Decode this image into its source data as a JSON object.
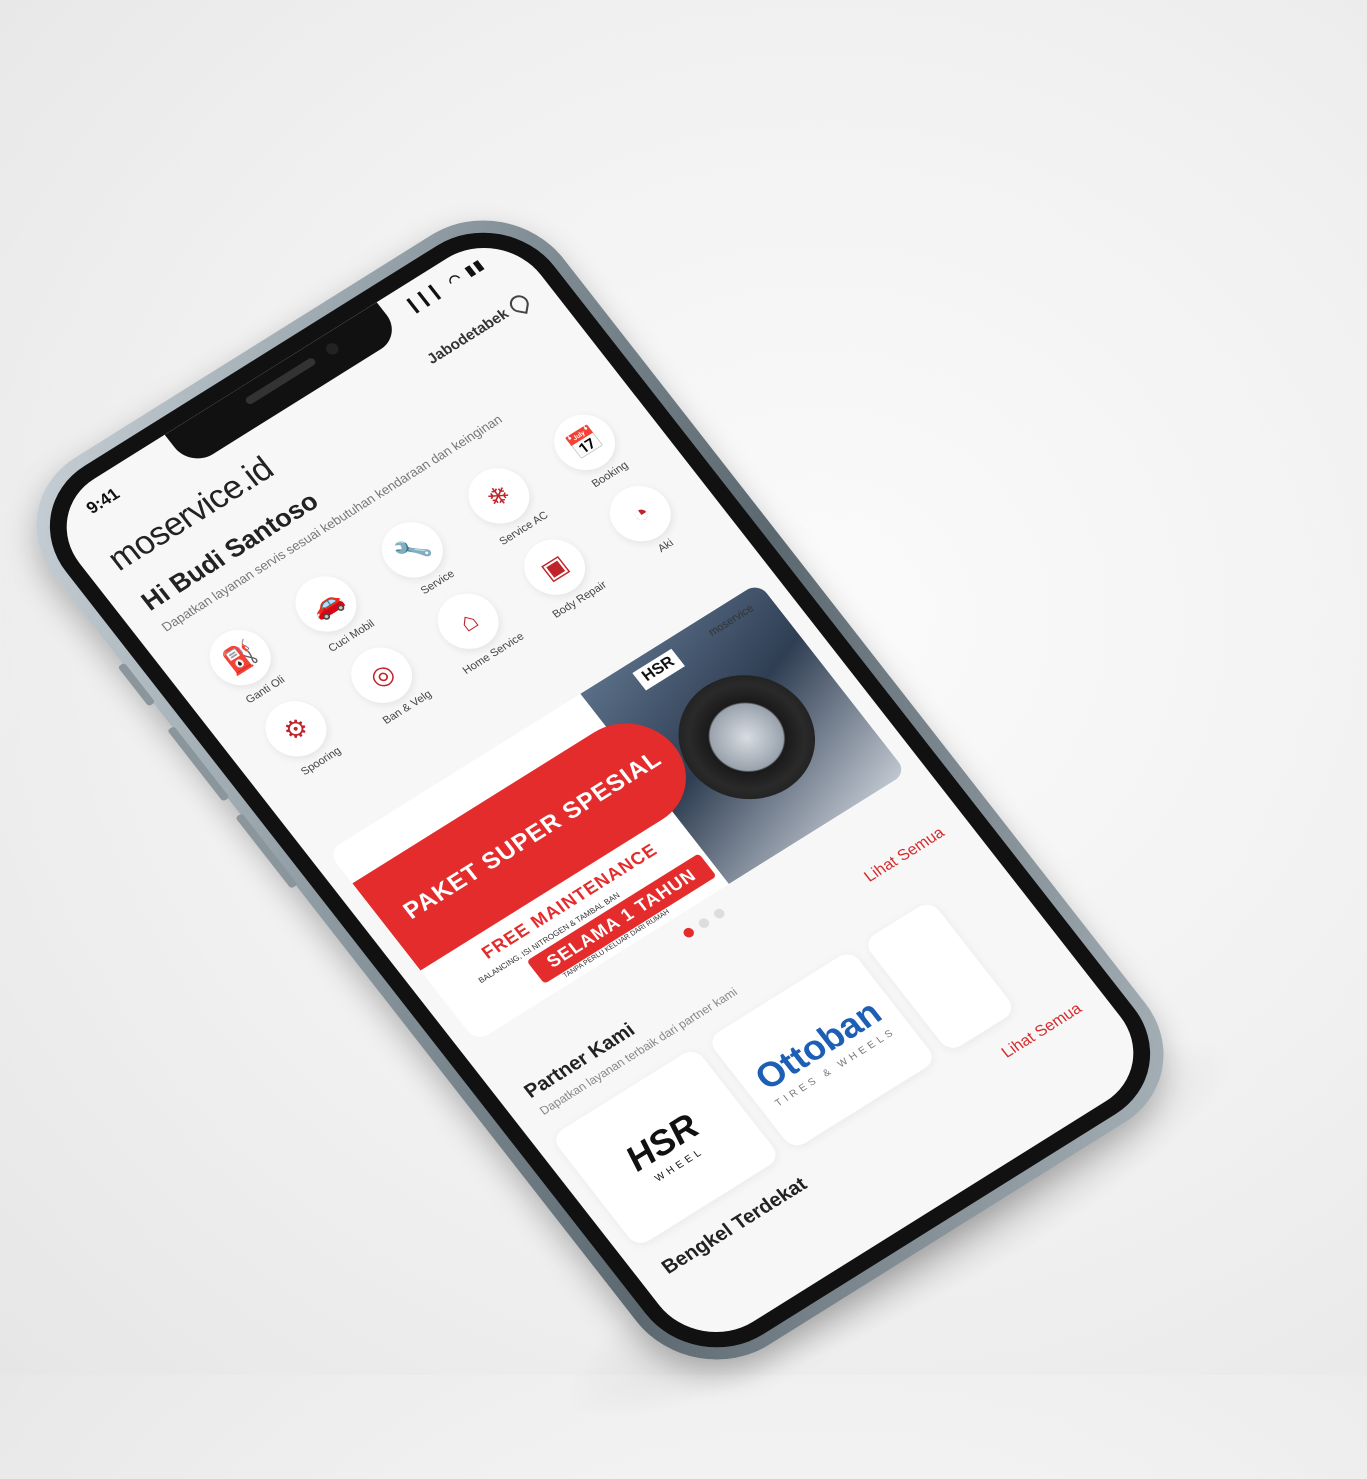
{
  "status_bar": {
    "time": "9:41",
    "icons": "▎▎▎ ◠ ▮▮"
  },
  "header": {
    "logo": "moservice.id",
    "location": "Jabodetabek"
  },
  "greeting": {
    "title": "Hi Budi Santoso",
    "subtitle": "Dapatkan layanan servis sesuai kebutuhan kendaraan dan keinginan"
  },
  "services": [
    {
      "label": "Ganti Oli",
      "icon": "oil-icon",
      "glyph": "⛽"
    },
    {
      "label": "Cuci Mobil",
      "icon": "car-wash-icon",
      "glyph": "🚗"
    },
    {
      "label": "Service",
      "icon": "wrench-icon",
      "glyph": "🔧"
    },
    {
      "label": "Service AC",
      "icon": "car-ac-icon",
      "glyph": "❄"
    },
    {
      "label": "Booking",
      "icon": "calendar-icon",
      "glyph": "📅"
    },
    {
      "label": "Spooring",
      "icon": "spooring-icon",
      "glyph": "⚙"
    },
    {
      "label": "Ban & Velg",
      "icon": "tire-icon",
      "glyph": "◎"
    },
    {
      "label": "Home Service",
      "icon": "home-icon",
      "glyph": "⌂"
    },
    {
      "label": "Body Repair",
      "icon": "body-repair-icon",
      "glyph": "▣"
    },
    {
      "label": "Aki",
      "icon": "battery-icon",
      "glyph": "◔"
    }
  ],
  "banner": {
    "headline": "PAKET SUPER SPESIAL",
    "line1": "FREE MAINTENANCE",
    "line2": "BALANCING, ISI NITROGEN & TAMBAL BAN",
    "pill": "SELAMA 1 TAHUN",
    "line3": "TANPA PERLU KELUAR DARI RUMAH",
    "brand": "HSR",
    "brand2": "moservice"
  },
  "carousel": {
    "count": 3,
    "active": 0
  },
  "partners": {
    "title": "Partner Kami",
    "subtitle": "Dapatkan layanan terbaik dari partner kami",
    "see_all": "Lihat Semua",
    "items": [
      {
        "name": "HSR",
        "tag": "WHEEL"
      },
      {
        "name": "Ottoban",
        "tag": "TIRES & WHEELS"
      }
    ]
  },
  "nearby": {
    "title": "Bengkel Terdekat",
    "see_all": "Lihat Semua"
  },
  "colors": {
    "accent": "#e52c2c",
    "partner_blue": "#1d5fb4"
  }
}
